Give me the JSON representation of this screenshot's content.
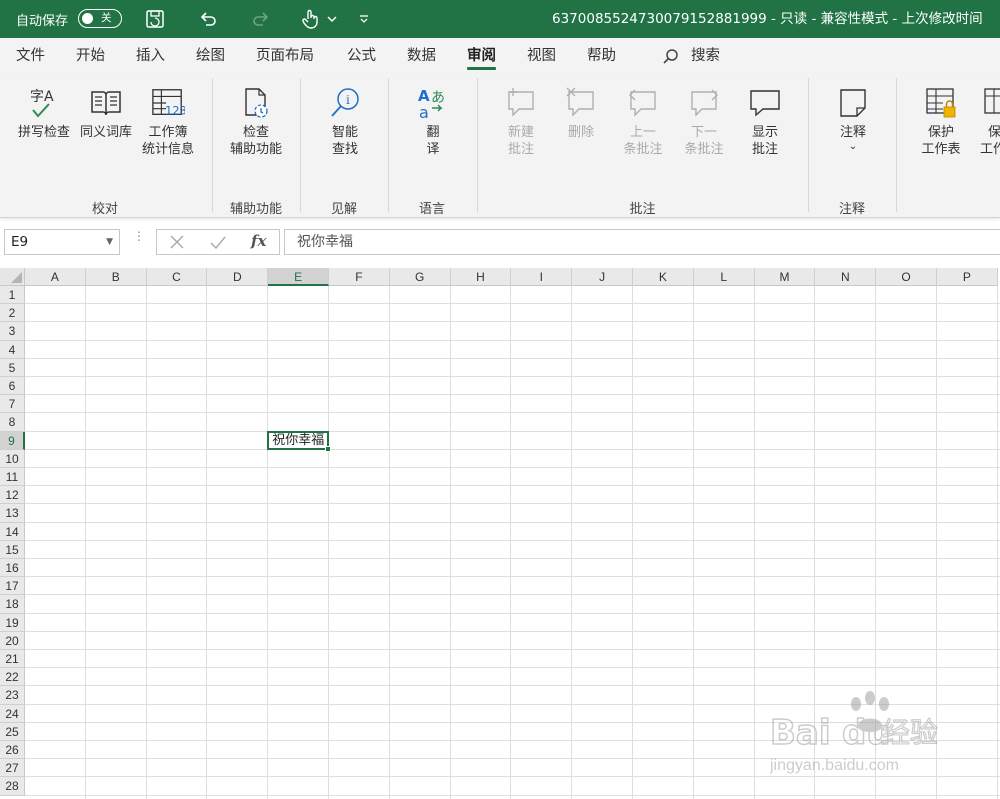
{
  "titlebar": {
    "autosave_label": "自动保存",
    "autosave_state": "关",
    "title": "637008552473007915288​1999 - 只读 - 兼容性模式 - 上次修改时间"
  },
  "tabs": [
    {
      "label": "文件"
    },
    {
      "label": "开始"
    },
    {
      "label": "插入"
    },
    {
      "label": "绘图"
    },
    {
      "label": "页面布局"
    },
    {
      "label": "公式"
    },
    {
      "label": "数据"
    },
    {
      "label": "审阅"
    },
    {
      "label": "视图"
    },
    {
      "label": "帮助"
    }
  ],
  "search_label": "搜索",
  "ribbon": {
    "spell_line1": "拼写检查",
    "thesaurus_line1": "同义词库",
    "stats_line1": "工作簿",
    "stats_line2": "统计信息",
    "accessibility_line1": "检查",
    "accessibility_line2": "辅助功能",
    "smart_line1": "智能",
    "smart_line2": "查找",
    "translate_line1": "翻",
    "translate_line2": "译",
    "new_comment_line1": "新建",
    "new_comment_line2": "批注",
    "delete_line1": "删除",
    "prev_line1": "上一",
    "prev_line2": "条批注",
    "next_line1": "下一",
    "next_line2": "条批注",
    "show_line1": "显示",
    "show_line2": "批注",
    "notes_line1": "注释",
    "protect_sheet_line1": "保护",
    "protect_sheet_line2": "工作表",
    "protect_wb_line1": "保",
    "protect_wb_line2": "工作",
    "groups": {
      "proofing": "校对",
      "accessibility": "辅助功能",
      "insights": "见解",
      "language": "语言",
      "comments": "批注",
      "notes": "注释"
    }
  },
  "formula_bar": {
    "name_box": "E9",
    "fx": "fx",
    "value": "祝你幸福"
  },
  "grid": {
    "columns": [
      "A",
      "B",
      "C",
      "D",
      "E",
      "F",
      "G",
      "H",
      "I",
      "J",
      "K",
      "L",
      "M",
      "N",
      "O",
      "P"
    ],
    "rows": [
      "1",
      "2",
      "3",
      "4",
      "5",
      "6",
      "7",
      "8",
      "9",
      "10",
      "11",
      "12",
      "13",
      "14",
      "15",
      "16",
      "17",
      "18",
      "19",
      "20",
      "21",
      "22",
      "23",
      "24",
      "25",
      "26",
      "27",
      "28"
    ],
    "active_cell_value": "祝你幸福"
  },
  "watermark": {
    "brand": "Bai du 经验",
    "url": "jingyan.baidu.com"
  },
  "colors": {
    "accent": "#217346"
  }
}
